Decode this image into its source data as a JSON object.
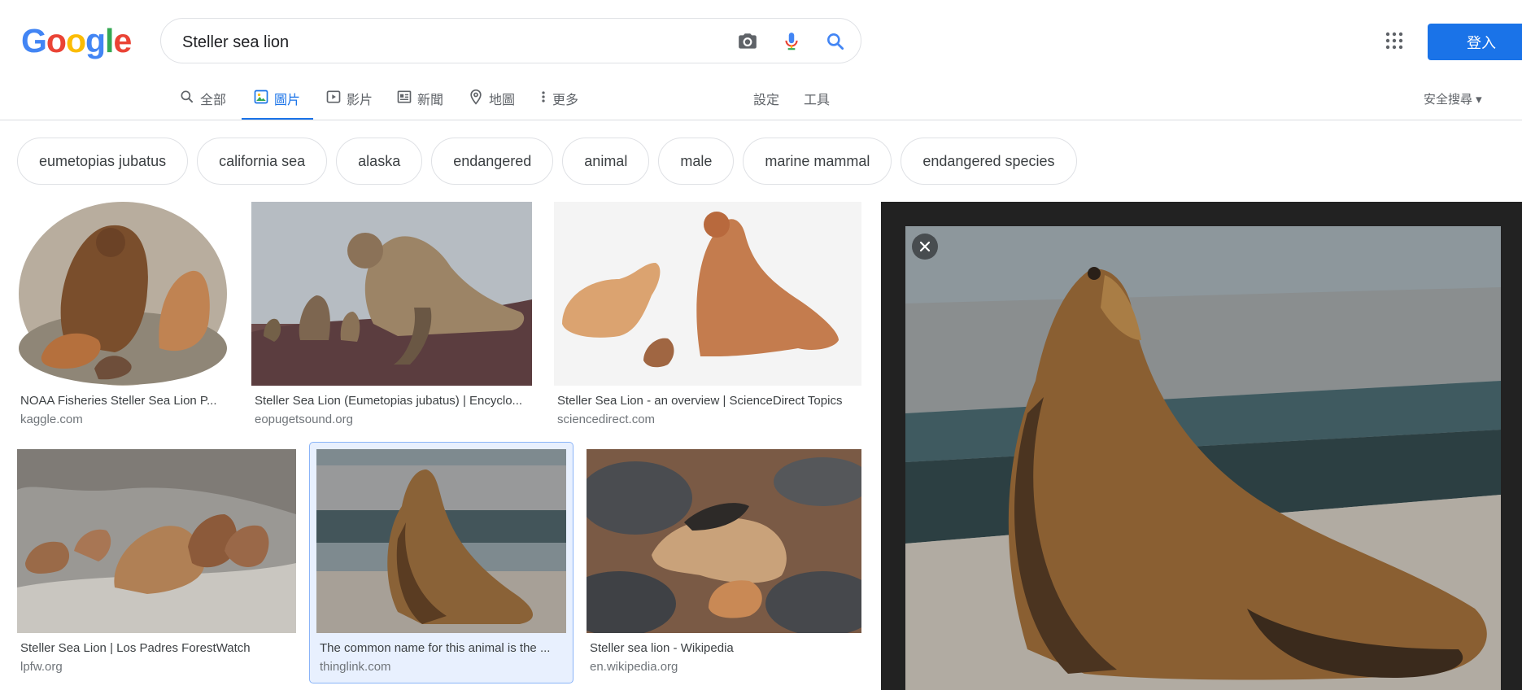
{
  "logo": {
    "letters": [
      "G",
      "o",
      "o",
      "g",
      "l",
      "e"
    ]
  },
  "search": {
    "value": "Steller sea lion"
  },
  "header": {
    "signin": "登入"
  },
  "tabs": [
    {
      "label": "全部",
      "icon": "search-icon"
    },
    {
      "label": "圖片",
      "icon": "image-icon",
      "active": true
    },
    {
      "label": "影片",
      "icon": "video-icon"
    },
    {
      "label": "新聞",
      "icon": "news-icon"
    },
    {
      "label": "地圖",
      "icon": "map-pin-icon"
    },
    {
      "label": "更多",
      "icon": "more-vert-icon"
    }
  ],
  "tools": {
    "settings": "設定",
    "tools": "工具",
    "safe_search": "安全搜尋 ▾"
  },
  "chips": [
    "eumetopias jubatus",
    "california sea",
    "alaska",
    "endangered",
    "animal",
    "male",
    "marine mammal",
    "endangered species"
  ],
  "results": [
    {
      "title": "NOAA Fisheries Steller Sea Lion P...",
      "source": "kaggle.com"
    },
    {
      "title": "Steller Sea Lion (Eumetopias jubatus) | Encyclo...",
      "source": "eopugetsound.org"
    },
    {
      "title": "Steller Sea Lion - an overview | ScienceDirect Topics",
      "source": "sciencedirect.com"
    },
    {
      "title": "Steller Sea Lion | Los Padres ForestWatch",
      "source": "lpfw.org"
    },
    {
      "title": "The common name for this animal is the ...",
      "source": "thinglink.com",
      "selected": true
    },
    {
      "title": "Steller sea lion - Wikipedia",
      "source": "en.wikipedia.org"
    }
  ],
  "colors": {
    "blue": "#4285F4",
    "red": "#EA4335",
    "yellow": "#FBBC05",
    "green": "#34A853",
    "accent": "#1a73e8"
  }
}
